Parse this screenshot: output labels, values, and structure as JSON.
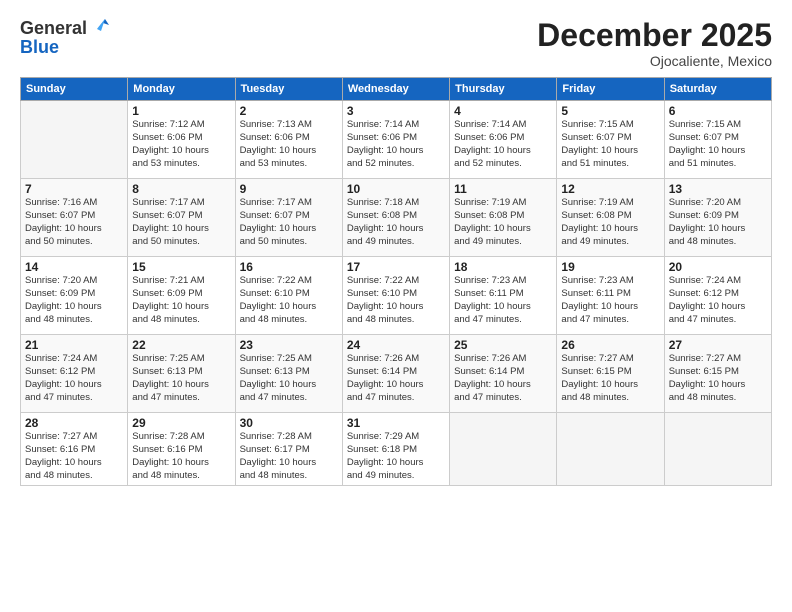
{
  "logo": {
    "line1": "General",
    "line2": "Blue"
  },
  "title": "December 2025",
  "subtitle": "Ojocaliente, Mexico",
  "weekdays": [
    "Sunday",
    "Monday",
    "Tuesday",
    "Wednesday",
    "Thursday",
    "Friday",
    "Saturday"
  ],
  "weeks": [
    [
      {
        "day": "",
        "info": ""
      },
      {
        "day": "1",
        "info": "Sunrise: 7:12 AM\nSunset: 6:06 PM\nDaylight: 10 hours\nand 53 minutes."
      },
      {
        "day": "2",
        "info": "Sunrise: 7:13 AM\nSunset: 6:06 PM\nDaylight: 10 hours\nand 53 minutes."
      },
      {
        "day": "3",
        "info": "Sunrise: 7:14 AM\nSunset: 6:06 PM\nDaylight: 10 hours\nand 52 minutes."
      },
      {
        "day": "4",
        "info": "Sunrise: 7:14 AM\nSunset: 6:06 PM\nDaylight: 10 hours\nand 52 minutes."
      },
      {
        "day": "5",
        "info": "Sunrise: 7:15 AM\nSunset: 6:07 PM\nDaylight: 10 hours\nand 51 minutes."
      },
      {
        "day": "6",
        "info": "Sunrise: 7:15 AM\nSunset: 6:07 PM\nDaylight: 10 hours\nand 51 minutes."
      }
    ],
    [
      {
        "day": "7",
        "info": "Sunrise: 7:16 AM\nSunset: 6:07 PM\nDaylight: 10 hours\nand 50 minutes."
      },
      {
        "day": "8",
        "info": "Sunrise: 7:17 AM\nSunset: 6:07 PM\nDaylight: 10 hours\nand 50 minutes."
      },
      {
        "day": "9",
        "info": "Sunrise: 7:17 AM\nSunset: 6:07 PM\nDaylight: 10 hours\nand 50 minutes."
      },
      {
        "day": "10",
        "info": "Sunrise: 7:18 AM\nSunset: 6:08 PM\nDaylight: 10 hours\nand 49 minutes."
      },
      {
        "day": "11",
        "info": "Sunrise: 7:19 AM\nSunset: 6:08 PM\nDaylight: 10 hours\nand 49 minutes."
      },
      {
        "day": "12",
        "info": "Sunrise: 7:19 AM\nSunset: 6:08 PM\nDaylight: 10 hours\nand 49 minutes."
      },
      {
        "day": "13",
        "info": "Sunrise: 7:20 AM\nSunset: 6:09 PM\nDaylight: 10 hours\nand 48 minutes."
      }
    ],
    [
      {
        "day": "14",
        "info": "Sunrise: 7:20 AM\nSunset: 6:09 PM\nDaylight: 10 hours\nand 48 minutes."
      },
      {
        "day": "15",
        "info": "Sunrise: 7:21 AM\nSunset: 6:09 PM\nDaylight: 10 hours\nand 48 minutes."
      },
      {
        "day": "16",
        "info": "Sunrise: 7:22 AM\nSunset: 6:10 PM\nDaylight: 10 hours\nand 48 minutes."
      },
      {
        "day": "17",
        "info": "Sunrise: 7:22 AM\nSunset: 6:10 PM\nDaylight: 10 hours\nand 48 minutes."
      },
      {
        "day": "18",
        "info": "Sunrise: 7:23 AM\nSunset: 6:11 PM\nDaylight: 10 hours\nand 47 minutes."
      },
      {
        "day": "19",
        "info": "Sunrise: 7:23 AM\nSunset: 6:11 PM\nDaylight: 10 hours\nand 47 minutes."
      },
      {
        "day": "20",
        "info": "Sunrise: 7:24 AM\nSunset: 6:12 PM\nDaylight: 10 hours\nand 47 minutes."
      }
    ],
    [
      {
        "day": "21",
        "info": "Sunrise: 7:24 AM\nSunset: 6:12 PM\nDaylight: 10 hours\nand 47 minutes."
      },
      {
        "day": "22",
        "info": "Sunrise: 7:25 AM\nSunset: 6:13 PM\nDaylight: 10 hours\nand 47 minutes."
      },
      {
        "day": "23",
        "info": "Sunrise: 7:25 AM\nSunset: 6:13 PM\nDaylight: 10 hours\nand 47 minutes."
      },
      {
        "day": "24",
        "info": "Sunrise: 7:26 AM\nSunset: 6:14 PM\nDaylight: 10 hours\nand 47 minutes."
      },
      {
        "day": "25",
        "info": "Sunrise: 7:26 AM\nSunset: 6:14 PM\nDaylight: 10 hours\nand 47 minutes."
      },
      {
        "day": "26",
        "info": "Sunrise: 7:27 AM\nSunset: 6:15 PM\nDaylight: 10 hours\nand 48 minutes."
      },
      {
        "day": "27",
        "info": "Sunrise: 7:27 AM\nSunset: 6:15 PM\nDaylight: 10 hours\nand 48 minutes."
      }
    ],
    [
      {
        "day": "28",
        "info": "Sunrise: 7:27 AM\nSunset: 6:16 PM\nDaylight: 10 hours\nand 48 minutes."
      },
      {
        "day": "29",
        "info": "Sunrise: 7:28 AM\nSunset: 6:16 PM\nDaylight: 10 hours\nand 48 minutes."
      },
      {
        "day": "30",
        "info": "Sunrise: 7:28 AM\nSunset: 6:17 PM\nDaylight: 10 hours\nand 48 minutes."
      },
      {
        "day": "31",
        "info": "Sunrise: 7:29 AM\nSunset: 6:18 PM\nDaylight: 10 hours\nand 49 minutes."
      },
      {
        "day": "",
        "info": ""
      },
      {
        "day": "",
        "info": ""
      },
      {
        "day": "",
        "info": ""
      }
    ]
  ]
}
